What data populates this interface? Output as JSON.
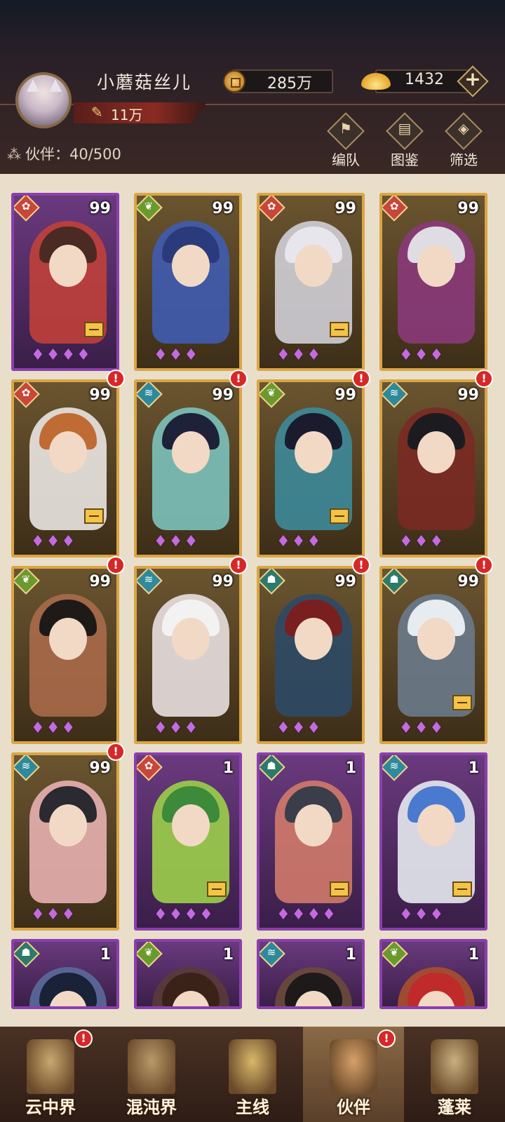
{
  "player": {
    "name": "小蘑菇丝儿",
    "power": "11万"
  },
  "resources": {
    "coins": "285万",
    "gold": "1432",
    "add_label": "+"
  },
  "partner_count": {
    "label": "伙伴：",
    "value": "40/500"
  },
  "tools": [
    {
      "label": "编队",
      "icon": "formation-flag-icon",
      "glyph": "⚑"
    },
    {
      "label": "图鉴",
      "icon": "scroll-book-icon",
      "glyph": "▤"
    },
    {
      "label": "筛选",
      "icon": "filter-diamond-icon",
      "glyph": "◈"
    }
  ],
  "alert_mark": "!",
  "cards": [
    {
      "level": "99",
      "element": "fox",
      "frame": "purple",
      "stars": "♦♦♦♦",
      "badge": true,
      "alert": false,
      "hero": "#c0403a",
      "hair": "#4a2a22"
    },
    {
      "level": "99",
      "element": "leaf",
      "frame": "gold",
      "stars": "♦♦♦",
      "badge": false,
      "alert": false,
      "hero": "#3f5cb0",
      "hair": "#2b3a7a"
    },
    {
      "level": "99",
      "element": "fox",
      "frame": "gold",
      "stars": "♦♦♦",
      "badge": true,
      "alert": false,
      "hero": "#cfcfd6",
      "hair": "#e6e6ec"
    },
    {
      "level": "99",
      "element": "fox",
      "frame": "gold",
      "stars": "♦♦♦",
      "badge": false,
      "alert": false,
      "hero": "#8a3a7a",
      "hair": "#dfdce4"
    },
    {
      "level": "99",
      "element": "fox",
      "frame": "gold",
      "stars": "♦♦♦",
      "badge": true,
      "alert": true,
      "hero": "#eae6e2",
      "hair": "#c06a34"
    },
    {
      "level": "99",
      "element": "wave",
      "frame": "gold",
      "stars": "♦♦♦",
      "badge": false,
      "alert": true,
      "hero": "#7bc2bb",
      "hair": "#1e2238"
    },
    {
      "level": "99",
      "element": "leaf",
      "frame": "gold",
      "stars": "♦♦♦",
      "badge": true,
      "alert": true,
      "hero": "#3d8a9a",
      "hair": "#1a1c2e"
    },
    {
      "level": "99",
      "element": "wave",
      "frame": "gold",
      "stars": "♦♦♦",
      "badge": false,
      "alert": true,
      "hero": "#7a2a22",
      "hair": "#1c1c20"
    },
    {
      "level": "99",
      "element": "leaf",
      "frame": "gold",
      "stars": "♦♦♦",
      "badge": false,
      "alert": true,
      "hero": "#a86a4a",
      "hair": "#1e1a18"
    },
    {
      "level": "99",
      "element": "wave",
      "frame": "gold",
      "stars": "♦♦♦",
      "badge": false,
      "alert": true,
      "hero": "#e8e0e0",
      "hair": "#f2f2f2"
    },
    {
      "level": "99",
      "element": "ghost",
      "frame": "gold",
      "stars": "♦♦♦",
      "badge": false,
      "alert": true,
      "hero": "#2e4a66",
      "hair": "#7a1f1f"
    },
    {
      "level": "99",
      "element": "ghost",
      "frame": "gold",
      "stars": "♦♦♦",
      "badge": true,
      "alert": true,
      "hero": "#6a7a8a",
      "hair": "#e6ecf0"
    },
    {
      "level": "99",
      "element": "wave",
      "frame": "gold",
      "stars": "♦♦♦",
      "badge": false,
      "alert": true,
      "hero": "#e8b0b0",
      "hair": "#2a2a30"
    },
    {
      "level": "1",
      "element": "fox",
      "frame": "purple",
      "stars": "♦♦♦♦",
      "badge": true,
      "alert": false,
      "hero": "#9ccf4a",
      "hair": "#3d8a3a"
    },
    {
      "level": "1",
      "element": "ghost",
      "frame": "purple",
      "stars": "♦♦♦♦",
      "badge": true,
      "alert": false,
      "hero": "#d07a6a",
      "hair": "#3a3e4a"
    },
    {
      "level": "1",
      "element": "wave",
      "frame": "purple",
      "stars": "♦♦♦",
      "badge": true,
      "alert": false,
      "hero": "#e6eaf0",
      "hair": "#4a7ad0"
    },
    {
      "level": "1",
      "element": "ghost",
      "frame": "purple",
      "stars": "",
      "badge": false,
      "alert": false,
      "hero": "#5a6a9a",
      "hair": "#1a2238"
    },
    {
      "level": "1",
      "element": "leaf",
      "frame": "purple",
      "stars": "",
      "badge": false,
      "alert": false,
      "hero": "#5a3a3a",
      "hair": "#3a2218"
    },
    {
      "level": "1",
      "element": "wave",
      "frame": "purple",
      "stars": "",
      "badge": false,
      "alert": false,
      "hero": "#6a4a3a",
      "hair": "#1e1a1a"
    },
    {
      "level": "1",
      "element": "leaf",
      "frame": "purple",
      "stars": "",
      "badge": false,
      "alert": false,
      "hero": "#a8502e",
      "hair": "#c02a2a"
    }
  ],
  "nav": [
    {
      "label": "云中界",
      "alert": true,
      "active": false,
      "icon": "cloud-pavilion-icon"
    },
    {
      "label": "混沌界",
      "alert": false,
      "active": false,
      "icon": "chaos-shrine-icon"
    },
    {
      "label": "主线",
      "alert": false,
      "active": false,
      "icon": "crossed-swords-icon"
    },
    {
      "label": "伙伴",
      "alert": true,
      "active": true,
      "icon": "partner-character-icon"
    },
    {
      "label": "蓬莱",
      "alert": false,
      "active": false,
      "icon": "penglai-elder-icon"
    }
  ],
  "colors": {
    "gold_frame": "#d9a545",
    "purple_frame": "#8b3fae",
    "alert_red": "#d62828",
    "fox": "#c8463a",
    "leaf": "#6a9a2e",
    "wave": "#2e8a9a",
    "ghost": "#2e7a6a"
  }
}
